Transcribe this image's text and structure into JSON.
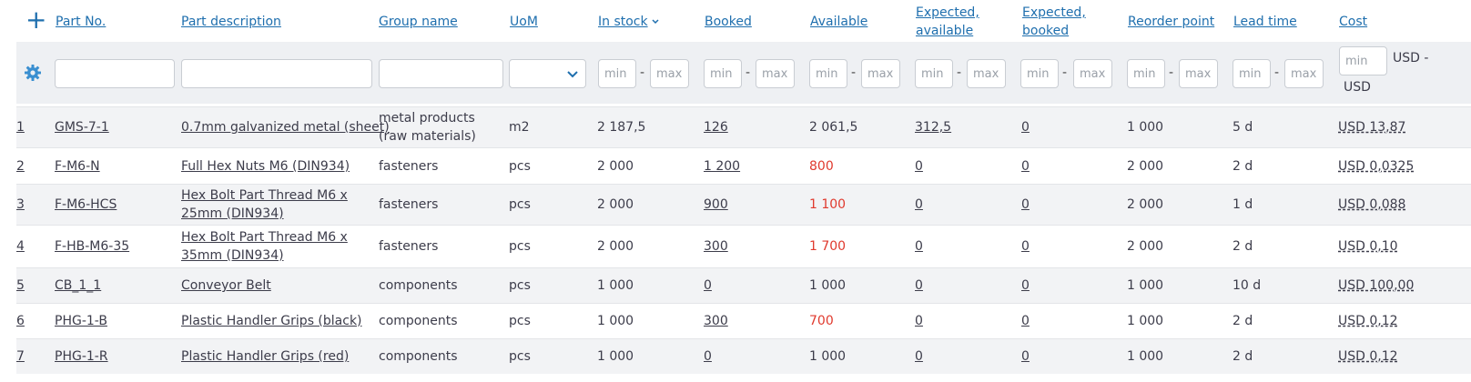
{
  "toolbar": {
    "add_icon": "plus-icon",
    "settings_icon": "gear-icon"
  },
  "headers": {
    "part_no": "Part No.",
    "description": "Part description",
    "group": "Group name",
    "uom": "UoM",
    "in_stock": "In stock",
    "booked": "Booked",
    "available": "Available",
    "exp_available": [
      "Expected,",
      "available"
    ],
    "exp_booked": [
      "Expected,",
      "booked"
    ],
    "reorder": "Reorder point",
    "lead_time": "Lead time",
    "cost": "Cost"
  },
  "filters": {
    "min_placeholder": "min",
    "max_placeholder": "max",
    "cost_currency_a": "USD -",
    "cost_currency_b": "USD"
  },
  "colors": {
    "link": "#1f6fae",
    "negative": "#e03a2e",
    "gear": "#3a8fd0"
  },
  "rows": [
    {
      "num": "1",
      "part_no": "GMS-7-1",
      "description": "0.7mm galvanized metal (sheet)",
      "group": "metal products (raw materials)",
      "uom": "m2",
      "in_stock": "2 187,5",
      "booked": "126",
      "available": "2 061,5",
      "available_low": false,
      "exp_available": "312,5",
      "exp_booked": "0",
      "reorder": "1 000",
      "lead_time": "5 d",
      "cost": "USD 13,87"
    },
    {
      "num": "2",
      "part_no": "F-M6-N",
      "description": "Full Hex Nuts M6 (DIN934)",
      "group": "fasteners",
      "uom": "pcs",
      "in_stock": "2 000",
      "booked": "1 200",
      "available": "800",
      "available_low": true,
      "exp_available": "0",
      "exp_booked": "0",
      "reorder": "2 000",
      "lead_time": "2 d",
      "cost": "USD 0,0325"
    },
    {
      "num": "3",
      "part_no": "F-M6-HCS",
      "description": "Hex Bolt Part Thread M6 x 25mm (DIN934)",
      "group": "fasteners",
      "uom": "pcs",
      "in_stock": "2 000",
      "booked": "900",
      "available": "1 100",
      "available_low": true,
      "exp_available": "0",
      "exp_booked": "0",
      "reorder": "2 000",
      "lead_time": "1 d",
      "cost": "USD 0,088"
    },
    {
      "num": "4",
      "part_no": "F-HB-M6-35",
      "description": "Hex Bolt Part Thread M6 x 35mm (DIN934)",
      "group": "fasteners",
      "uom": "pcs",
      "in_stock": "2 000",
      "booked": "300",
      "available": "1 700",
      "available_low": true,
      "exp_available": "0",
      "exp_booked": "0",
      "reorder": "2 000",
      "lead_time": "2 d",
      "cost": "USD 0,10"
    },
    {
      "num": "5",
      "part_no": "CB_1_1",
      "description": "Conveyor Belt",
      "group": "components",
      "uom": "pcs",
      "in_stock": "1 000",
      "booked": "0",
      "available": "1 000",
      "available_low": false,
      "exp_available": "0",
      "exp_booked": "0",
      "reorder": "1 000",
      "lead_time": "10 d",
      "cost": "USD 100,00"
    },
    {
      "num": "6",
      "part_no": "PHG-1-B",
      "description": "Plastic Handler Grips (black)",
      "group": "components",
      "uom": "pcs",
      "in_stock": "1 000",
      "booked": "300",
      "available": "700",
      "available_low": true,
      "exp_available": "0",
      "exp_booked": "0",
      "reorder": "1 000",
      "lead_time": "2 d",
      "cost": "USD 0,12"
    },
    {
      "num": "7",
      "part_no": "PHG-1-R",
      "description": "Plastic Handler Grips (red)",
      "group": "components",
      "uom": "pcs",
      "in_stock": "1 000",
      "booked": "0",
      "available": "1 000",
      "available_low": false,
      "exp_available": "0",
      "exp_booked": "0",
      "reorder": "1 000",
      "lead_time": "2 d",
      "cost": "USD 0,12"
    }
  ]
}
